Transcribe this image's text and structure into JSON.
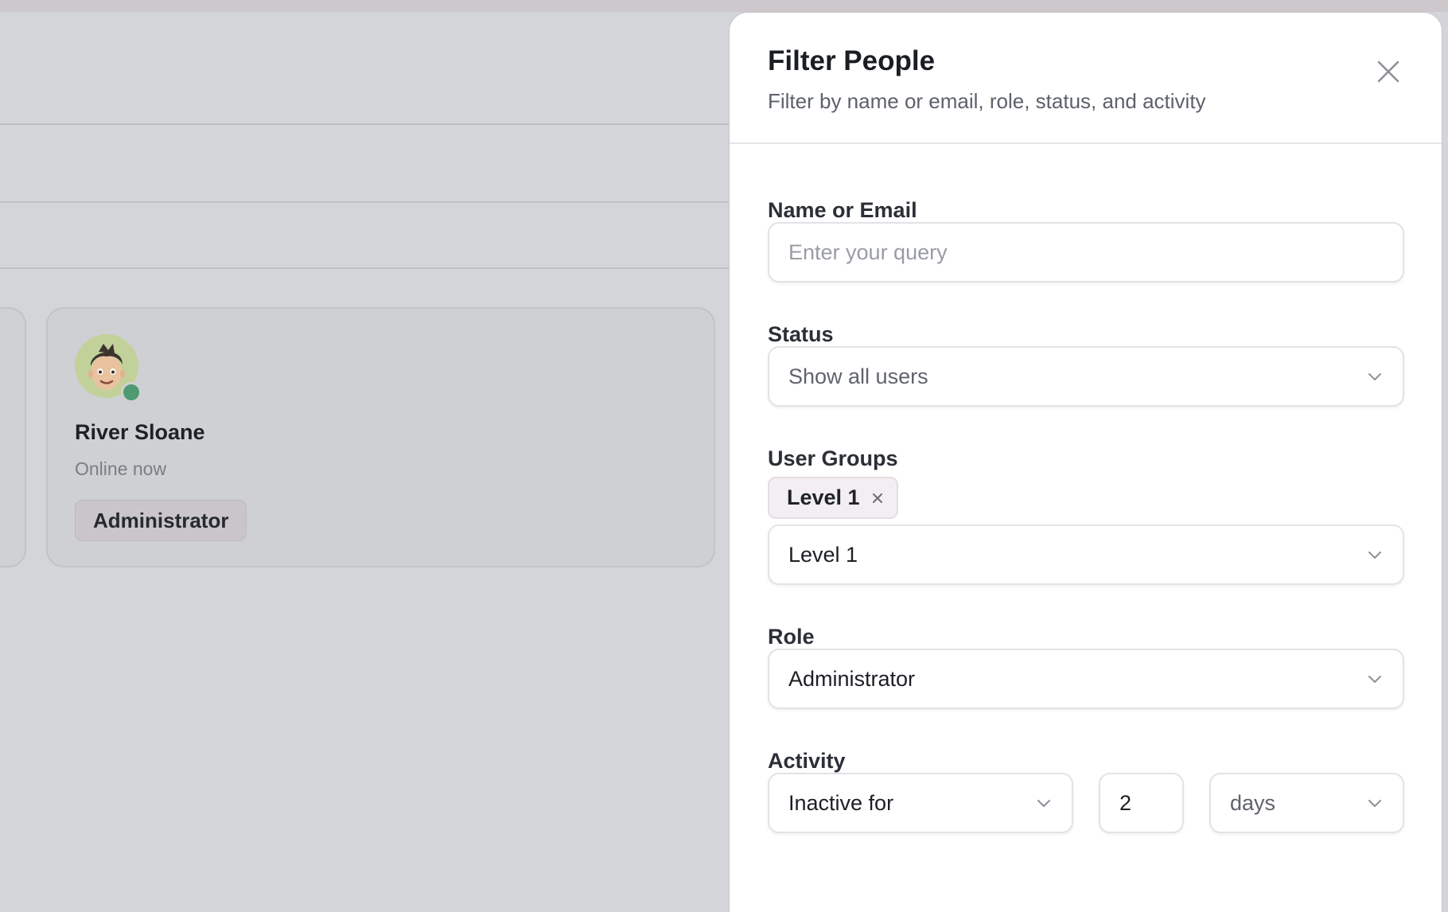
{
  "card": {
    "name": "River Sloane",
    "status": "Online now",
    "role": "Administrator"
  },
  "drawer": {
    "title": "Filter People",
    "subtitle": "Filter by name or email, role, status, and activity",
    "fields": {
      "name_or_email": {
        "label": "Name or Email",
        "placeholder": "Enter your query",
        "value": ""
      },
      "status": {
        "label": "Status",
        "value": "Show all users"
      },
      "user_groups": {
        "label": "User Groups",
        "chip": "Level 1",
        "value": "Level 1"
      },
      "role": {
        "label": "Role",
        "value": "Administrator"
      },
      "activity": {
        "label": "Activity",
        "mode": "Inactive for",
        "amount": "2",
        "unit": "days"
      }
    }
  },
  "colors": {
    "presence": "#4f9a72",
    "avatar_bg": "#c2d19a"
  },
  "icons": [
    "close-icon",
    "chevron-down-icon",
    "chip-remove-icon"
  ]
}
